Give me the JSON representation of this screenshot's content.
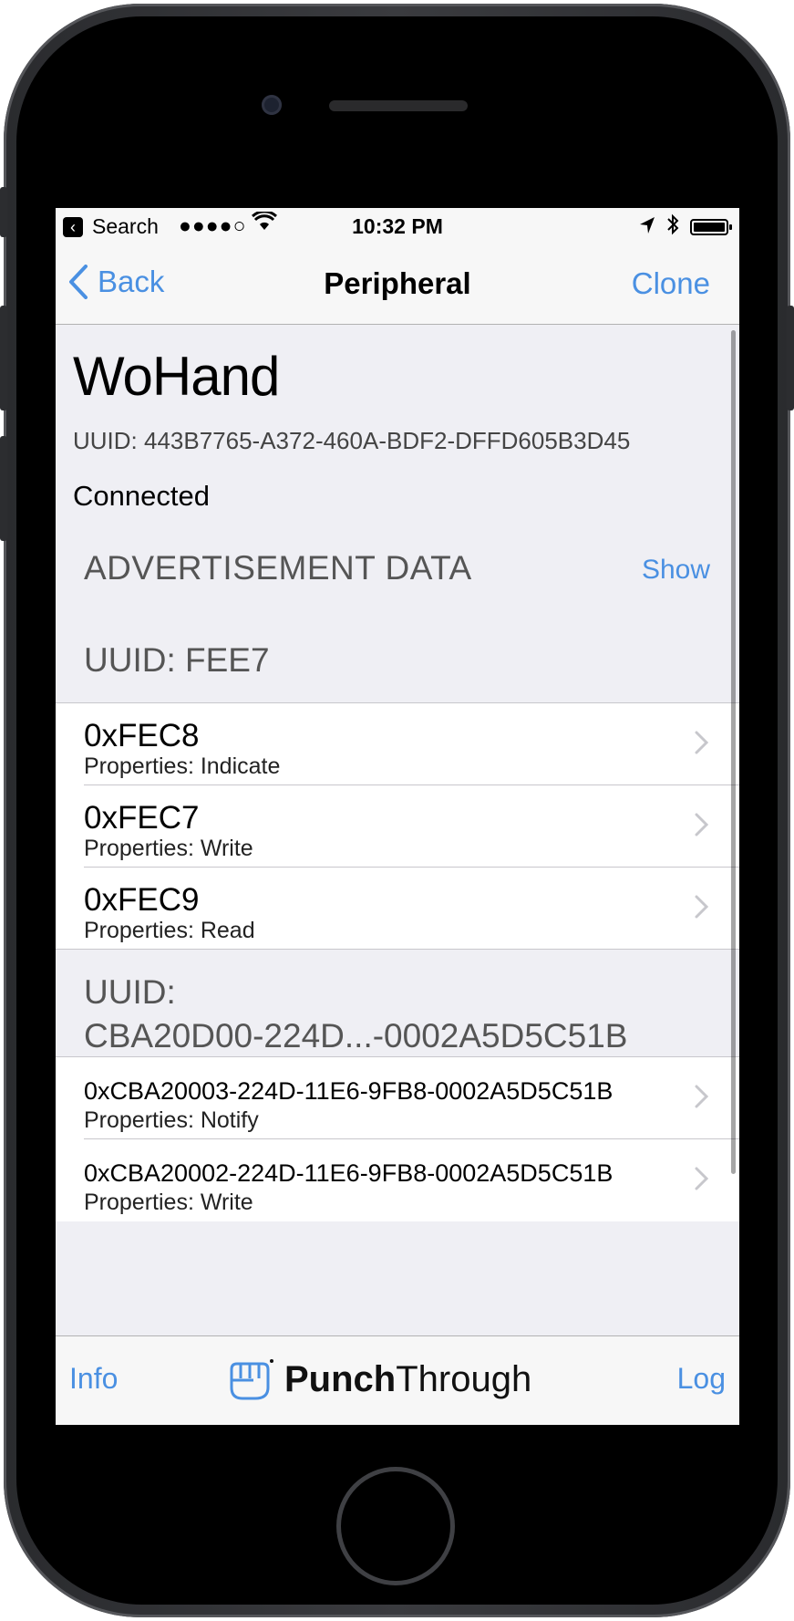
{
  "status_bar": {
    "back_app": "Search",
    "signal": "●●●●○",
    "time": "10:32 PM"
  },
  "nav": {
    "back_label": "Back",
    "title": "Peripheral",
    "clone_label": "Clone"
  },
  "device": {
    "name": "WoHand",
    "uuid": "UUID: 443B7765-A372-460A-BDF2-DFFD605B3D45",
    "state": "Connected"
  },
  "advertisement": {
    "header": "ADVERTISEMENT DATA",
    "show_label": "Show"
  },
  "services": [
    {
      "header": "UUID: FEE7",
      "characteristics": [
        {
          "name": "0xFEC8",
          "properties": "Properties: Indicate"
        },
        {
          "name": "0xFEC7",
          "properties": "Properties: Write"
        },
        {
          "name": "0xFEC9",
          "properties": "Properties: Read"
        }
      ]
    },
    {
      "header_line1": "UUID:",
      "header_line2": "CBA20D00-224D...-0002A5D5C51B",
      "characteristics": [
        {
          "name": "0xCBA20003-224D-11E6-9FB8-0002A5D5C51B",
          "properties": "Properties: Notify"
        },
        {
          "name": "0xCBA20002-224D-11E6-9FB8-0002A5D5C51B",
          "properties": "Properties: Write"
        }
      ]
    }
  ],
  "toolbar": {
    "info_label": "Info",
    "brand_bold": "Punch",
    "brand_regular": "Through",
    "log_label": "Log"
  },
  "colors": {
    "accent": "#4a90e2",
    "background": "#efeff4",
    "cell": "#ffffff"
  }
}
